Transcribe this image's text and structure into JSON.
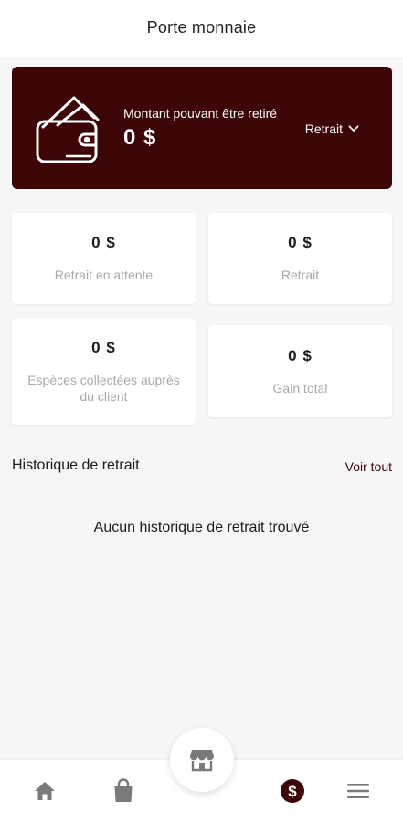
{
  "header": {
    "title": "Porte monnaie"
  },
  "balance": {
    "label": "Montant pouvant être retiré",
    "amount": "0 $",
    "withdraw_label": "Retrait"
  },
  "stats": [
    {
      "amount": "0 $",
      "label": "Retrait en attente"
    },
    {
      "amount": "0 $",
      "label": "Retrait"
    },
    {
      "amount": "0 $",
      "label": "Espèces collectées auprès du client"
    },
    {
      "amount": "0 $",
      "label": "Gain total"
    }
  ],
  "history": {
    "title": "Historique de retrait",
    "see_all": "Voir tout",
    "empty_message": "Aucun historique de retrait trouvé"
  },
  "nav": {
    "items": [
      "home-icon",
      "shopping-bag-icon",
      "store-icon",
      "dollar-coin-icon",
      "menu-icon"
    ],
    "active": "dollar-coin-icon"
  },
  "colors": {
    "accent": "#3d0505",
    "background": "#f6f6f6",
    "card": "#ffffff",
    "muted_text": "#a8a8a8",
    "nav_icon": "#7a7a7a"
  }
}
